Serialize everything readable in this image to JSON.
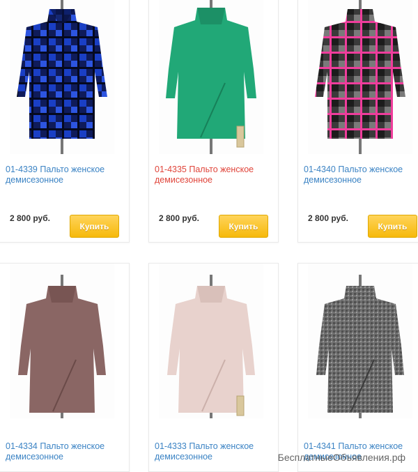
{
  "products": [
    {
      "id": "p1",
      "title": "01-4339 Пальто женское демисезонное",
      "price": "2 800 руб.",
      "buy_label": "Купить",
      "color": "#1f42c6",
      "pattern": "check-blue",
      "active": false
    },
    {
      "id": "p2",
      "title": "01-4335 Пальто женское демисезонное",
      "price": "2 800 руб.",
      "buy_label": "Купить",
      "color": "#21a877",
      "pattern": "plain",
      "active": true
    },
    {
      "id": "p3",
      "title": "01-4340 Пальто женское демисезонное",
      "price": "2 800 руб.",
      "buy_label": "Купить",
      "color": "#e2459a",
      "pattern": "check-pink",
      "active": false
    },
    {
      "id": "p4",
      "title": "01-4334 Пальто женское демисезонное",
      "color": "#8a6664",
      "pattern": "plain",
      "active": false
    },
    {
      "id": "p5",
      "title": "01-4333 Пальто женское демисезонное",
      "color": "#e8d2cd",
      "pattern": "plain",
      "active": false
    },
    {
      "id": "p6",
      "title": "01-4341 Пальто женское демисезонное",
      "color": "#6b6b6b",
      "pattern": "tweed",
      "active": false
    }
  ],
  "watermark": "БесплатныеОбъявления.рф"
}
